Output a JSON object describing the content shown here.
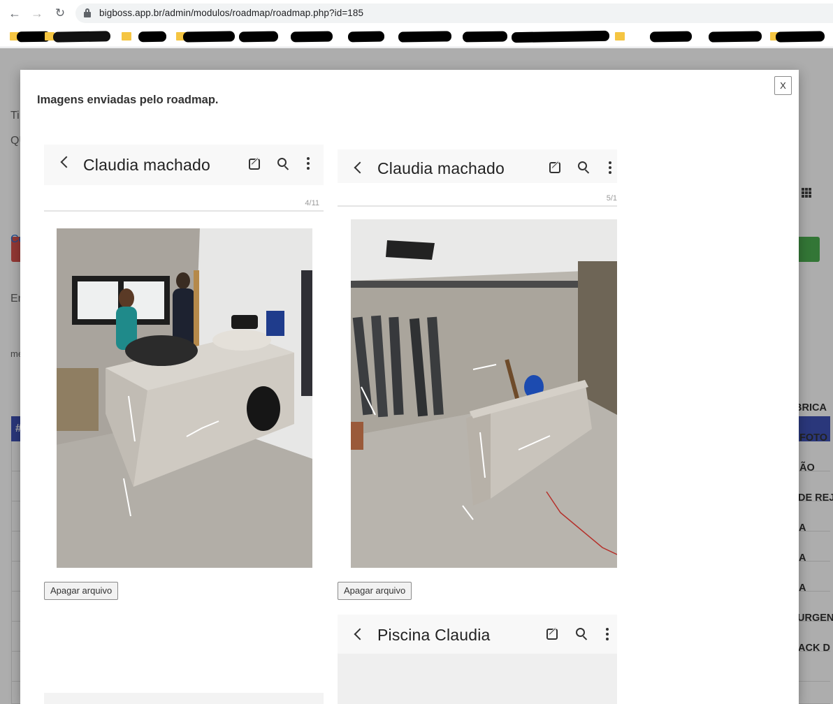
{
  "browser": {
    "url": "bigboss.app.br/admin/modulos/roadmap/roadmap.php?id=185",
    "back_icon": "arrow-left-icon",
    "forward_icon": "arrow-right-icon",
    "reload_icon": "reload-icon"
  },
  "background_page": {
    "labels": [
      "Ti",
      "QU",
      "Ce",
      "En",
      "me",
      "#"
    ],
    "table_rows": [
      "BRICA",
      "FOTO",
      "ÃO",
      "DE REJ",
      "A",
      "A",
      "A",
      "URGENT",
      "ACK D"
    ],
    "colors": {
      "header": "#3f51b5",
      "danger": "#d9534f",
      "success": "#4caf50"
    }
  },
  "modal": {
    "close_label": "X",
    "title": "Imagens enviadas pelo roadmap.",
    "cards": [
      {
        "header_title": "Claudia machado",
        "page_counter": "4/11",
        "delete_label": "Apagar arquivo"
      },
      {
        "header_title": "Claudia machado",
        "page_counter": "5/1",
        "delete_label": "Apagar arquivo"
      },
      {
        "header_title": "Piscina Claudia"
      }
    ]
  }
}
